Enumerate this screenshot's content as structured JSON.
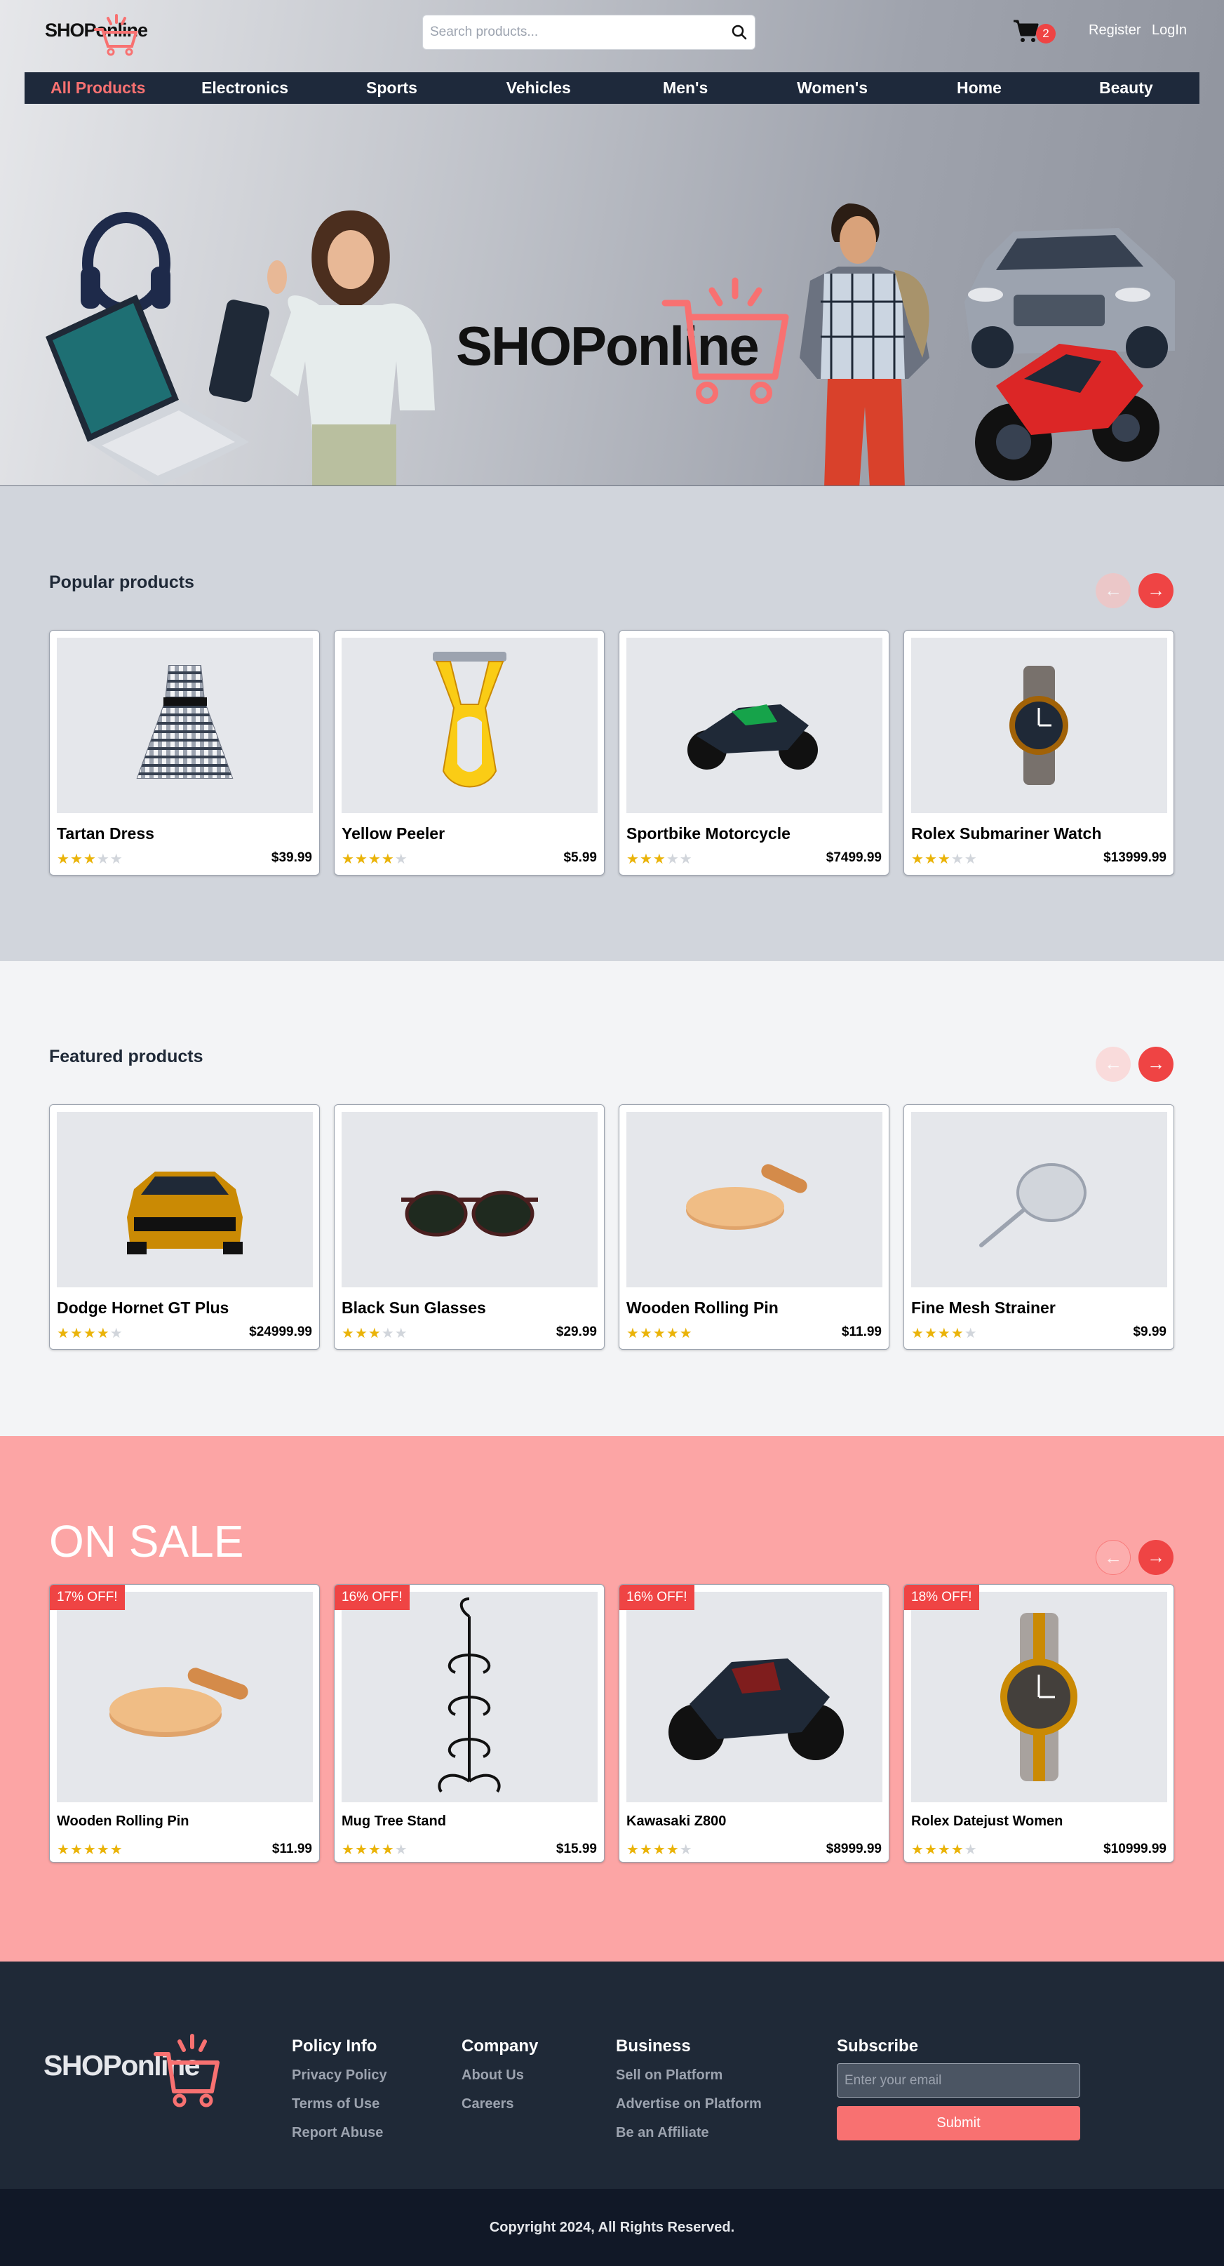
{
  "header": {
    "logo": "SHOPonline",
    "search_placeholder": "Search products...",
    "cart_count": "2",
    "register_label": "Register",
    "login_label": "LogIn"
  },
  "nav": [
    {
      "label": "All Products",
      "active": true
    },
    {
      "label": "Electronics"
    },
    {
      "label": "Sports"
    },
    {
      "label": "Vehicles"
    },
    {
      "label": "Men's"
    },
    {
      "label": "Women's"
    },
    {
      "label": "Home"
    },
    {
      "label": "Beauty"
    }
  ],
  "hero": {
    "logo": "SHOPonline"
  },
  "popular": {
    "title": "Popular products",
    "prev": "←",
    "next": "→",
    "products": [
      {
        "name": "Tartan Dress",
        "price": "$39.99",
        "rating": 3
      },
      {
        "name": "Yellow Peeler",
        "price": "$5.99",
        "rating": 4
      },
      {
        "name": "Sportbike Motorcycle",
        "price": "$7499.99",
        "rating": 3
      },
      {
        "name": "Rolex Submariner Watch",
        "price": "$13999.99",
        "rating": 3
      }
    ]
  },
  "featured": {
    "title": "Featured products",
    "prev": "←",
    "next": "→",
    "products": [
      {
        "name": "Dodge Hornet GT Plus",
        "price": "$24999.99",
        "rating": 4
      },
      {
        "name": "Black Sun Glasses",
        "price": "$29.99",
        "rating": 3
      },
      {
        "name": "Wooden Rolling Pin",
        "price": "$11.99",
        "rating": 5
      },
      {
        "name": "Fine Mesh Strainer",
        "price": "$9.99",
        "rating": 4
      }
    ]
  },
  "sale": {
    "title": "ON SALE",
    "prev": "←",
    "next": "→",
    "products": [
      {
        "name": "Wooden Rolling Pin",
        "price": "$11.99",
        "rating": 5,
        "discount": "17% OFF!"
      },
      {
        "name": "Mug Tree Stand",
        "price": "$15.99",
        "rating": 4,
        "discount": "16% OFF!"
      },
      {
        "name": "Kawasaki Z800",
        "price": "$8999.99",
        "rating": 4,
        "discount": "16% OFF!"
      },
      {
        "name": "Rolex Datejust Women",
        "price": "$10999.99",
        "rating": 4,
        "discount": "18% OFF!"
      }
    ]
  },
  "footer": {
    "logo": "SHOPonline",
    "policy": {
      "title": "Policy Info",
      "links": [
        "Privacy Policy",
        "Terms of Use",
        "Report Abuse"
      ]
    },
    "company": {
      "title": "Company",
      "links": [
        "About Us",
        "Careers"
      ]
    },
    "business": {
      "title": "Business",
      "links": [
        "Sell on Platform",
        "Advertise on Platform",
        "Be an Affiliate"
      ]
    },
    "subscribe": {
      "title": "Subscribe",
      "placeholder": "Enter your email",
      "button": "Submit"
    },
    "copyright": "Copyright 2024, All Rights Reserved."
  },
  "colors": {
    "accent": "#ef4444",
    "nav_bg": "#1e293b",
    "footer_bg": "#1f2937",
    "sale_bg": "#fca5a5",
    "star": "#eab308"
  }
}
